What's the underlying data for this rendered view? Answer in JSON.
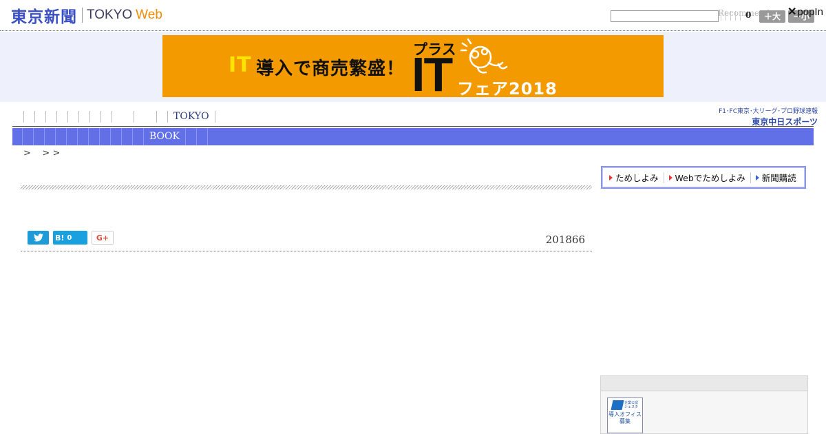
{
  "header": {
    "logo_jp": "東京新聞",
    "logo_tokyo": "TOKYO",
    "logo_web": "Web",
    "recommend_label": "Recommend",
    "count": "0",
    "font_bigger": "＋大",
    "font_smaller": "－小",
    "popin_label": "popIn"
  },
  "banner": {
    "it_small": "IT",
    "headline": "導入で商売繁盛！",
    "plus": "プラス",
    "it_big": "IT",
    "fair": "フェア2018"
  },
  "nav": {
    "tokyo_label": "TOKYO",
    "book_label": "BOOK",
    "chunichi_top": "F1･FC東京･大リーグ･プロ野球速報",
    "chunichi_bottom": "東京中日スポーツ"
  },
  "breadcrumb": ">    > >",
  "article": {
    "date": "201866",
    "hatena_label": "B!",
    "hatena_count": "0",
    "gplus_label": "G+"
  },
  "subscribe": {
    "item1": "ためしよみ",
    "item2": "Webでためしよみ",
    "item3": "新聞購読"
  },
  "side_ad": {
    "mini": "企業公認\nシェスタ",
    "text": "導入オフィス\n募集"
  },
  "colors": {
    "brand_blue": "#3b4fc4",
    "nav_blue": "#6270e8",
    "web_orange": "#f08a00",
    "banner_orange": "#f39a00"
  },
  "icons": [
    "twitter-icon",
    "popin-close-icon",
    "mascot-icon",
    "subscribe-arrow-icon"
  ]
}
